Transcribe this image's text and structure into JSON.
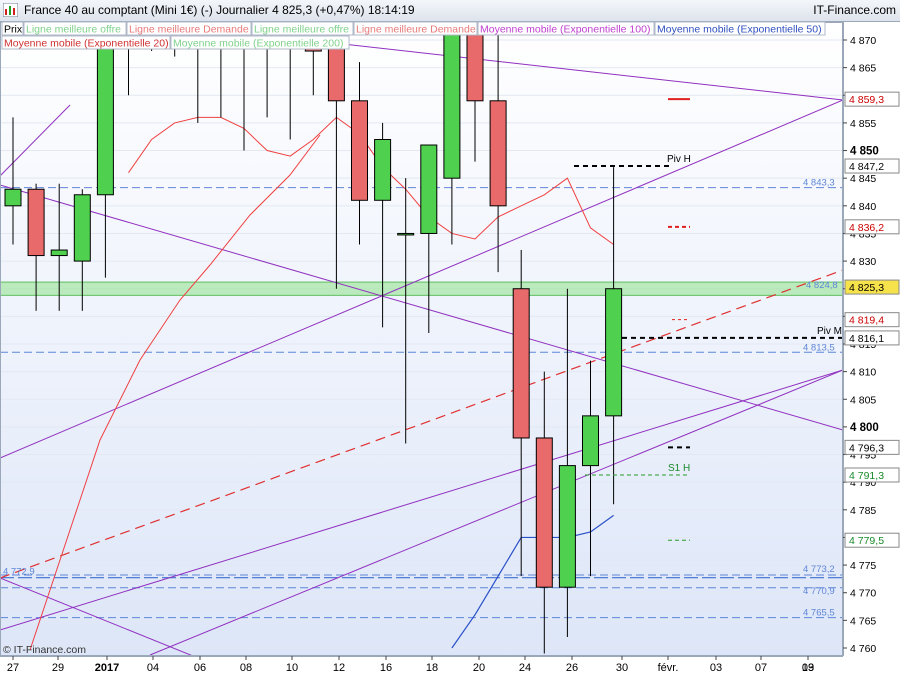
{
  "window": {
    "title": "France 40 au comptant (Mini 1€) (-)   Journalier   4 825,3 (+0,47%)   18:14:19",
    "brand": "IT-Finance.com"
  },
  "legend": [
    {
      "text": "Prix",
      "color": "#000000",
      "bg": "#ffffff"
    },
    {
      "text": "Ligne meilleure offre",
      "color": "#7fd18a",
      "bg": "#ffffff"
    },
    {
      "text": "Ligne meilleure Demande",
      "color": "#e87a7a",
      "bg": "#ffffff"
    },
    {
      "text": "Ligne meilleure offre",
      "color": "#7fd18a",
      "bg": "#ffffff"
    },
    {
      "text": "Ligne meilleure Demande",
      "color": "#e87a7a",
      "bg": "#ffffff"
    },
    {
      "text": "Moyenne mobile (Exponentielle 100)",
      "color": "#c040d0",
      "bg": "#ffffff"
    },
    {
      "text": "Moyenne mobile (Exponentielle 50)",
      "color": "#3050c0",
      "bg": "#ffffff"
    },
    {
      "text": "Moyenne mobile (Exponentielle 20)",
      "color": "#d03030",
      "bg": "#ffffff"
    },
    {
      "text": "Moyenne mobile (Exponentielle 200)",
      "color": "#7fd18a",
      "bg": "#ffffff"
    }
  ],
  "chart_data": {
    "type": "candlestick",
    "y_ticks": [
      4760,
      4765,
      4770,
      4775,
      4780,
      4785,
      4790,
      4795,
      4800,
      4805,
      4810,
      4815,
      4820,
      4825,
      4830,
      4835,
      4840,
      4845,
      4850,
      4855,
      4860,
      4865,
      4870
    ],
    "y_tick_labels": [
      "4 760",
      "4 765",
      "4 770",
      "4 775",
      "4 780",
      "4 785",
      "4 790",
      "4 795",
      "4 800",
      "4 805",
      "4 810",
      "4 815",
      "4 820",
      "4 825",
      "4 830",
      "4 835",
      "4 840",
      "4 845",
      "4 850",
      "4 855",
      "4 860",
      "4 865",
      "4 870"
    ],
    "y_bold_labels": [
      "4 800",
      "4 850"
    ],
    "ylim": [
      4759,
      4873
    ],
    "x_ticks": [
      {
        "idx": 0,
        "label": "27"
      },
      {
        "idx": 1,
        "label": "29"
      },
      {
        "idx": 2,
        "label": "2017",
        "bold": true
      },
      {
        "idx": 3,
        "label": "04"
      },
      {
        "idx": 4,
        "label": "06"
      },
      {
        "idx": 5,
        "label": "08"
      },
      {
        "idx": 6,
        "label": "10"
      },
      {
        "idx": 7,
        "label": "12"
      },
      {
        "idx": 8,
        "label": "16"
      },
      {
        "idx": 9,
        "label": "18"
      },
      {
        "idx": 10,
        "label": "20"
      },
      {
        "idx": 11,
        "label": "24"
      },
      {
        "idx": 12,
        "label": "26"
      },
      {
        "idx": 13,
        "label": "30"
      },
      {
        "idx": 14,
        "label": "févr."
      },
      {
        "idx": 15,
        "label": "03"
      },
      {
        "idx": 16,
        "label": "07"
      },
      {
        "idx": 17,
        "label": "09"
      },
      {
        "idx": 18,
        "label": "13"
      }
    ],
    "candles": [
      {
        "o": 4840,
        "h": 4856,
        "l": 4833,
        "c": 4843
      },
      {
        "o": 4843,
        "h": 4844,
        "l": 4821,
        "c": 4831
      },
      {
        "o": 4831,
        "h": 4844,
        "l": 4821,
        "c": 4832
      },
      {
        "o": 4830,
        "h": 4843,
        "l": 4821,
        "c": 4842
      },
      {
        "o": 4842,
        "h": 4883,
        "l": 4827,
        "c": 4880
      },
      {
        "o": 4880,
        "h": 4895,
        "l": 4860,
        "c": 4885
      },
      {
        "o": 4885,
        "h": 4901,
        "l": 4868,
        "c": 4880
      },
      {
        "o": 4880,
        "h": 4881,
        "l": 4867,
        "c": 4874
      },
      {
        "o": 4874,
        "h": 4878,
        "l": 4855,
        "c": 4873
      },
      {
        "o": 4873,
        "h": 4880,
        "l": 4856,
        "c": 4875
      },
      {
        "o": 4875,
        "h": 4877,
        "l": 4850,
        "c": 4872
      },
      {
        "o": 4872,
        "h": 4881,
        "l": 4856,
        "c": 4870
      },
      {
        "o": 4870,
        "h": 4885,
        "l": 4852,
        "c": 4880
      },
      {
        "o": 4880,
        "h": 4886,
        "l": 4860,
        "c": 4868
      },
      {
        "o": 4869,
        "h": 4880,
        "l": 4825,
        "c": 4859
      },
      {
        "o": 4859,
        "h": 4866,
        "l": 4833,
        "c": 4841
      },
      {
        "o": 4841,
        "h": 4855,
        "l": 4818,
        "c": 4852
      },
      {
        "o": 4835,
        "h": 4845,
        "l": 4797,
        "c": 4835
      },
      {
        "o": 4835,
        "h": 4850,
        "l": 4817,
        "c": 4851
      },
      {
        "o": 4845,
        "h": 4883,
        "l": 4833,
        "c": 4880
      },
      {
        "o": 4880,
        "h": 4889,
        "l": 4848,
        "c": 4859
      },
      {
        "o": 4859,
        "h": 4880,
        "l": 4828,
        "c": 4840
      },
      {
        "o": 4825,
        "h": 4832,
        "l": 4773,
        "c": 4798
      },
      {
        "o": 4798,
        "h": 4810,
        "l": 4759,
        "c": 4771
      },
      {
        "o": 4771,
        "h": 4825,
        "l": 4762,
        "c": 4793
      },
      {
        "o": 4793,
        "h": 4812,
        "l": 4773,
        "c": 4802
      },
      {
        "o": 4802,
        "h": 4847,
        "l": 4786,
        "c": 4825
      }
    ],
    "ema20": [
      null,
      null,
      null,
      null,
      null,
      4846,
      4852,
      4855,
      4856,
      4856,
      4854,
      4850,
      4849,
      4852,
      4856,
      4853,
      4847,
      4843,
      4838,
      4835,
      4834,
      4838,
      4840,
      4842,
      4845,
      4836,
      4833
    ],
    "ema50": [
      null,
      null,
      null,
      null,
      null,
      null,
      null,
      null,
      null,
      null,
      null,
      null,
      null,
      null,
      null,
      null,
      null,
      null,
      null,
      4760,
      4766,
      4773,
      4780,
      4780,
      4780,
      4781,
      4784
    ],
    "right_labels": [
      {
        "value": 4859.3,
        "text": "4 859,3",
        "color": "#cc0000",
        "bg": "#ffffff"
      },
      {
        "value": 4847.2,
        "text": "4 847,2",
        "color": "#000000",
        "bg": "#ffffff"
      },
      {
        "value": 4836.2,
        "text": "4 836,2",
        "color": "#cc0000",
        "bg": "#ffffff"
      },
      {
        "value": 4825.3,
        "text": "4 825,3",
        "color": "#000000",
        "bg": "#f6e34c"
      },
      {
        "value": 4819.4,
        "text": "4 819,4",
        "color": "#cc0000",
        "bg": "#ffffff"
      },
      {
        "value": 4816.1,
        "text": "4 816,1",
        "color": "#000000",
        "bg": "#ffffff"
      },
      {
        "value": 4796.3,
        "text": "4 796,3",
        "color": "#000000",
        "bg": "#ffffff"
      },
      {
        "value": 4791.3,
        "text": "4 791,3",
        "color": "#1a8a2a",
        "bg": "#ffffff"
      },
      {
        "value": 4779.5,
        "text": "4 779,5",
        "color": "#1a8a2a",
        "bg": "#ffffff"
      }
    ],
    "level_labels": [
      {
        "value": 4843.3,
        "text": "4 843,3"
      },
      {
        "value": 4824.8,
        "text": "4 824,8"
      },
      {
        "value": 4813.5,
        "text": "4 813,5"
      },
      {
        "value": 4773.2,
        "text": "4 773,2"
      },
      {
        "value": 4770.9,
        "text": "4 770,9"
      },
      {
        "value": 4765.5,
        "text": "4 765,5"
      },
      {
        "value": 4772.9,
        "text": "4 772,9"
      }
    ],
    "pivots": [
      {
        "text": "Piv H",
        "value": 4847.2
      },
      {
        "text": "Piv M",
        "value": 4816.1
      },
      {
        "text": "S1 H",
        "value": 4791.3
      }
    ],
    "copyright": "© IT-Finance.com"
  }
}
